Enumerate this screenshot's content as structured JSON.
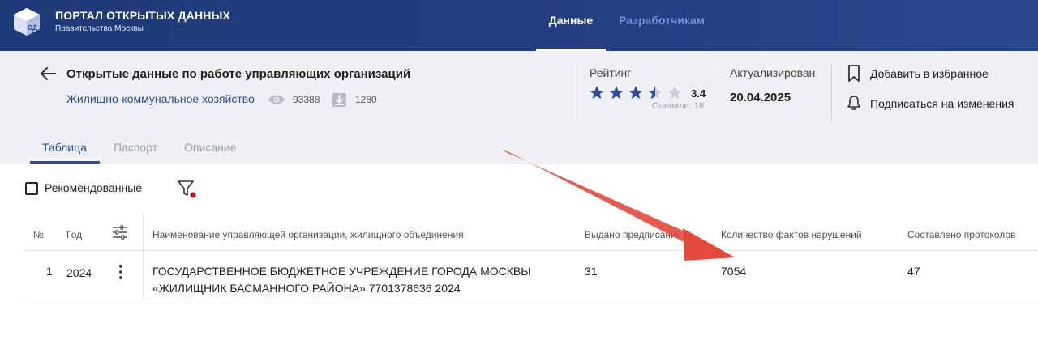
{
  "brand": {
    "title": "ПОРТАЛ ОТКРЫТЫХ ДАННЫХ",
    "subtitle": "Правительства Москвы",
    "logo_text": "ОД"
  },
  "nav": {
    "data_label": "Данные",
    "developers_label": "Разработчикам"
  },
  "dataset": {
    "title": "Открытые данные по работе управляющих организаций",
    "category": "Жилищно-коммунальное хозяйство",
    "views": "93388",
    "downloads": "1280"
  },
  "rating": {
    "label": "Рейтинг",
    "value": "3.4",
    "rated": "Оценили: 18"
  },
  "actualized": {
    "label": "Актуализирован",
    "date": "20.04.2025"
  },
  "actions": {
    "favorite_label": "Добавить в избранное",
    "subscribe_label": "Подписаться на изменения"
  },
  "tabs": {
    "table": "Таблица",
    "passport": "Паспорт",
    "description": "Описание"
  },
  "filters": {
    "recommended_label": "Рекомендованные"
  },
  "table": {
    "headers": {
      "num": "№",
      "year": "Год",
      "name": "Наименование управляющей организации, жилищного объединения",
      "issued": "Выдано предписаний",
      "facts": "Количество фактов нарушений",
      "protocols": "Составлено протоколов"
    },
    "rows": [
      {
        "num": "1",
        "year": "2024",
        "name_line1": "ГОСУДАРСТВЕННОЕ БЮДЖЕТНОЕ УЧРЕЖДЕНИЕ ГОРОДА МОСКВЫ",
        "name_line2": "«ЖИЛИЩНИК БАСМАННОГО РАЙОНА» 7701378636 2024",
        "issued": "31",
        "facts": "7054",
        "protocols": "47"
      }
    ]
  },
  "colors": {
    "header_bg": "#243f82",
    "accent": "#2d4d9a",
    "star": "#2d4d9a",
    "annotation_arrow": "#e24a3b",
    "filter_dot": "#c0101a"
  }
}
